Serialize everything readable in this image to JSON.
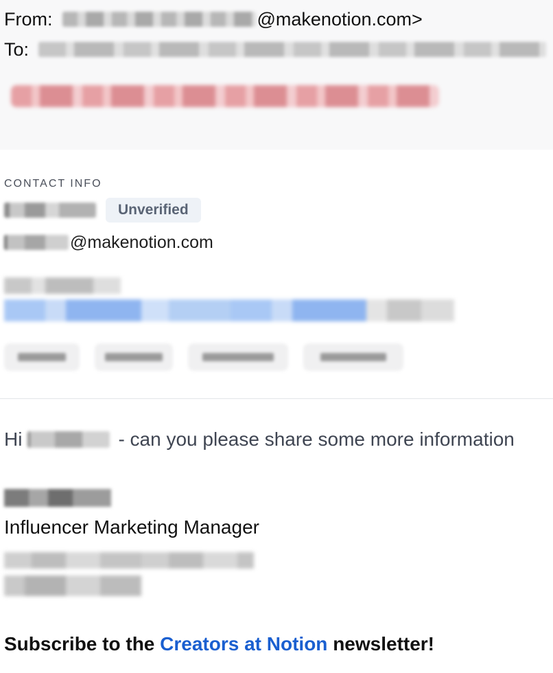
{
  "header": {
    "from_label": "From:",
    "from_domain": "@makenotion.com>",
    "to_label": "To:"
  },
  "contact": {
    "section_label": "CONTACT INFO",
    "badge": "Unverified",
    "email_domain": "@makenotion.com",
    "chips_count_visible": 4
  },
  "message": {
    "greeting_start": "Hi",
    "greeting_rest": "- can you please share some more information"
  },
  "signature": {
    "title": "Influencer Marketing Manager"
  },
  "footer": {
    "subscribe_prefix": "Subscribe to the",
    "subscribe_link": "Creators at Notion",
    "subscribe_suffix": "newsletter!"
  },
  "colors": {
    "header_bg": "#f8f8f9",
    "badge_bg": "#eef2f7",
    "badge_text": "#5a6475",
    "link": "#1a5fd0",
    "warning": "#e6a0a4"
  }
}
